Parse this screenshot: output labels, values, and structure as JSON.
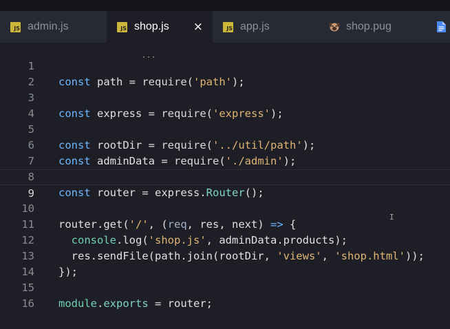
{
  "tabs": [
    {
      "label": "admin.js",
      "icon": "js-icon",
      "active": false
    },
    {
      "label": "shop.js",
      "icon": "js-icon",
      "active": true,
      "close": "×"
    },
    {
      "label": "app.js",
      "icon": "js-icon",
      "active": false
    },
    {
      "label": "shop.pug",
      "icon": "pug-icon",
      "active": false
    }
  ],
  "js_badge": "JS",
  "editor": {
    "current_line": 9,
    "lines": [
      {
        "n": "1"
      },
      {
        "n": "2"
      },
      {
        "n": "3"
      },
      {
        "n": "4"
      },
      {
        "n": "5"
      },
      {
        "n": "6"
      },
      {
        "n": "7"
      },
      {
        "n": "8"
      },
      {
        "n": "9"
      },
      {
        "n": "10"
      },
      {
        "n": "11"
      },
      {
        "n": "12"
      },
      {
        "n": "13"
      },
      {
        "n": "14"
      },
      {
        "n": "15"
      },
      {
        "n": "16"
      }
    ],
    "code": {
      "l1": {
        "kw": "const",
        "name": " path = ",
        "fn": "require",
        "open": "(",
        "str": "'path'",
        "close": ");"
      },
      "l3": {
        "kw": "const",
        "name": " express = ",
        "fn": "require",
        "open": "(",
        "str": "'express'",
        "close": ");"
      },
      "l5": {
        "kw": "const",
        "name": " rootDir = ",
        "fn": "require",
        "open": "(",
        "str": "'../util/path'",
        "close": ");"
      },
      "l6": {
        "kw": "const",
        "name": " adminData = ",
        "fn": "require",
        "open": "(",
        "str": "'./admin'",
        "close": ");"
      },
      "l8": {
        "kw": "const",
        "name": " router = express.",
        "prop": "Router",
        "close": "();"
      },
      "l10": {
        "a": "router.get(",
        "str": "'/'",
        "b": ", (",
        "p1": "req",
        "c1": ", ",
        "p2": "res",
        "c2": ", ",
        "p3": "next",
        "d": ") ",
        "arrow": "=>",
        "e": " {"
      },
      "l11": {
        "indent": "  ",
        "obj": "console",
        "a": ".log(",
        "str": "'shop.js'",
        "b": ", adminData.products);"
      },
      "l12": {
        "indent": "  ",
        "a": "res.sendFile(path.join(rootDir, ",
        "s1": "'views'",
        "c": ", ",
        "s2": "'shop.html'",
        "b": "));"
      },
      "l13": {
        "text": "});"
      },
      "l15": {
        "mod": "module",
        "a": ".",
        "prop": "exports",
        "b": " = router;"
      }
    }
  }
}
